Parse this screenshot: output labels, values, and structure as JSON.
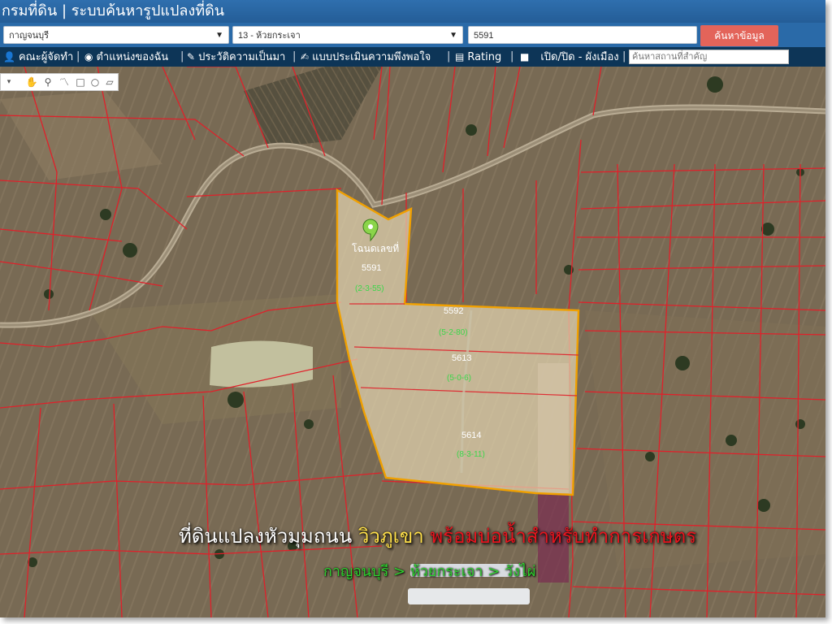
{
  "title": "กรมที่ดิน | ระบบค้นหารูปแปลงที่ดิน",
  "search": {
    "province": "กาญจนบุรี",
    "district": "13 - ห้วยกระเจา",
    "parcel_no": "5591",
    "button": "ค้นหาข้อมูล"
  },
  "toolbar": {
    "items": [
      "คณะผู้จัดทำ",
      "ตำแหน่งของฉัน",
      "ประวัติความเป็นมา",
      "แบบประเมินความพึงพอใจ",
      "Rating",
      "เปิด/ปิด - ผังเมือง"
    ],
    "place_placeholder": "ค้นหาสถานที่สำคัญ"
  },
  "map": {
    "marker_label": "โฉนดเลขที่",
    "parcels": [
      {
        "number": "5591",
        "area": "(2-3-55)"
      },
      {
        "number": "5592",
        "area": "(5-2-80)"
      },
      {
        "number": "5613",
        "area": "(5-0-6)"
      },
      {
        "number": "5614",
        "area": "(8-3-11)"
      }
    ],
    "overlay_title": [
      "ที่ดินแปลงหัวมุมถนน ",
      "วิวภูเขา ",
      "พร้อมบ่อน้ำสำหรับทำการเกษตร"
    ],
    "overlay_subtitle": "กาญจนบุรี > ห้วยกระเจา > วังไผ่"
  },
  "icons": [
    "hand-icon",
    "marker-icon",
    "polyline-icon",
    "rectangle-icon",
    "circle-icon",
    "polygon-icon",
    "users-icon",
    "location-icon",
    "history-icon",
    "survey-icon",
    "rating-icon",
    "checkbox-icon"
  ],
  "colors": {
    "title_bar": "#2f6fae",
    "toolbar": "#0d3557",
    "search_button": "#e3645a",
    "parcel_outline": "#f0a000",
    "parcel_lines": "#e0202a",
    "overlay_white": "#ffffff",
    "overlay_yellow": "#ffe04a",
    "overlay_red": "#e8141e",
    "overlay_green": "#2fd12f"
  }
}
